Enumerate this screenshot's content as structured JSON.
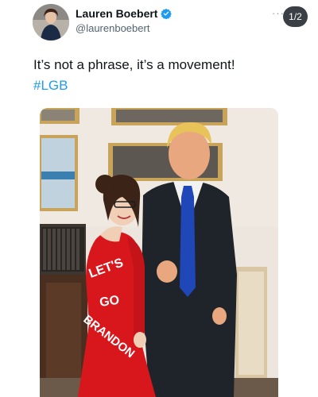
{
  "user": {
    "display_name": "Lauren Boebert",
    "handle": "@laurenboebert",
    "verified_icon": "verified-badge-icon",
    "avatar_icon": "avatar"
  },
  "header": {
    "page_indicator": "1/2",
    "more_icon": "more-options-icon"
  },
  "tweet": {
    "text": "It’s not a phrase, it’s a movement!",
    "hashtag": "#LGB"
  },
  "photo": {
    "description_icon": "tweet-photo",
    "dress_text_line1": "LET'S",
    "dress_text_line2": "GO",
    "dress_text_line3": "BRANDON"
  },
  "colors": {
    "hashtag": "#1d9bf0",
    "verified": "#1d9bf0",
    "dress": "#d8171d",
    "tie": "#1f47b8"
  }
}
